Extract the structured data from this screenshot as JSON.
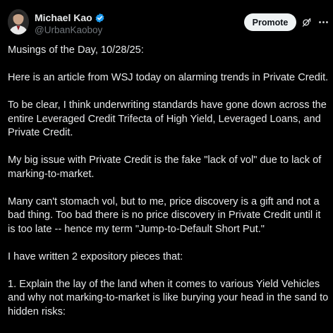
{
  "author": {
    "display_name": "Michael Kao",
    "handle": "@UrbanKaoboy",
    "verified": true
  },
  "actions": {
    "promote_label": "Promote",
    "grok_icon": "grok-icon",
    "more_icon": "more-icon"
  },
  "colors": {
    "background": "#000000",
    "text": "#e7e9ea",
    "secondary_text": "#71767b",
    "verified_badge": "#1d9bf0",
    "button_bg": "#eff3f4"
  },
  "post": {
    "paragraphs": [
      "Musings of the Day, 10/28/25:",
      "Here is an article from WSJ today on alarming trends in Private Credit.",
      "To be clear, I think underwriting standards have gone down across the entire Leveraged Credit Trifecta of High Yield, Leveraged Loans, and Private Credit.",
      "My big issue with Private Credit is the fake \"lack of vol\" due to lack of marking-to-market.",
      "Many can't stomach vol, but to me, price discovery is a gift and not a bad thing. Too bad there is no price discovery in Private Credit until it is too late -- hence my term \"Jump-to-Default Short Put.\"",
      "I have written 2 expository pieces that:",
      "1. Explain the lay of the land when it comes to various Yield Vehicles and why not marking-to-market is like burying your head in the sand to hidden risks:"
    ]
  }
}
